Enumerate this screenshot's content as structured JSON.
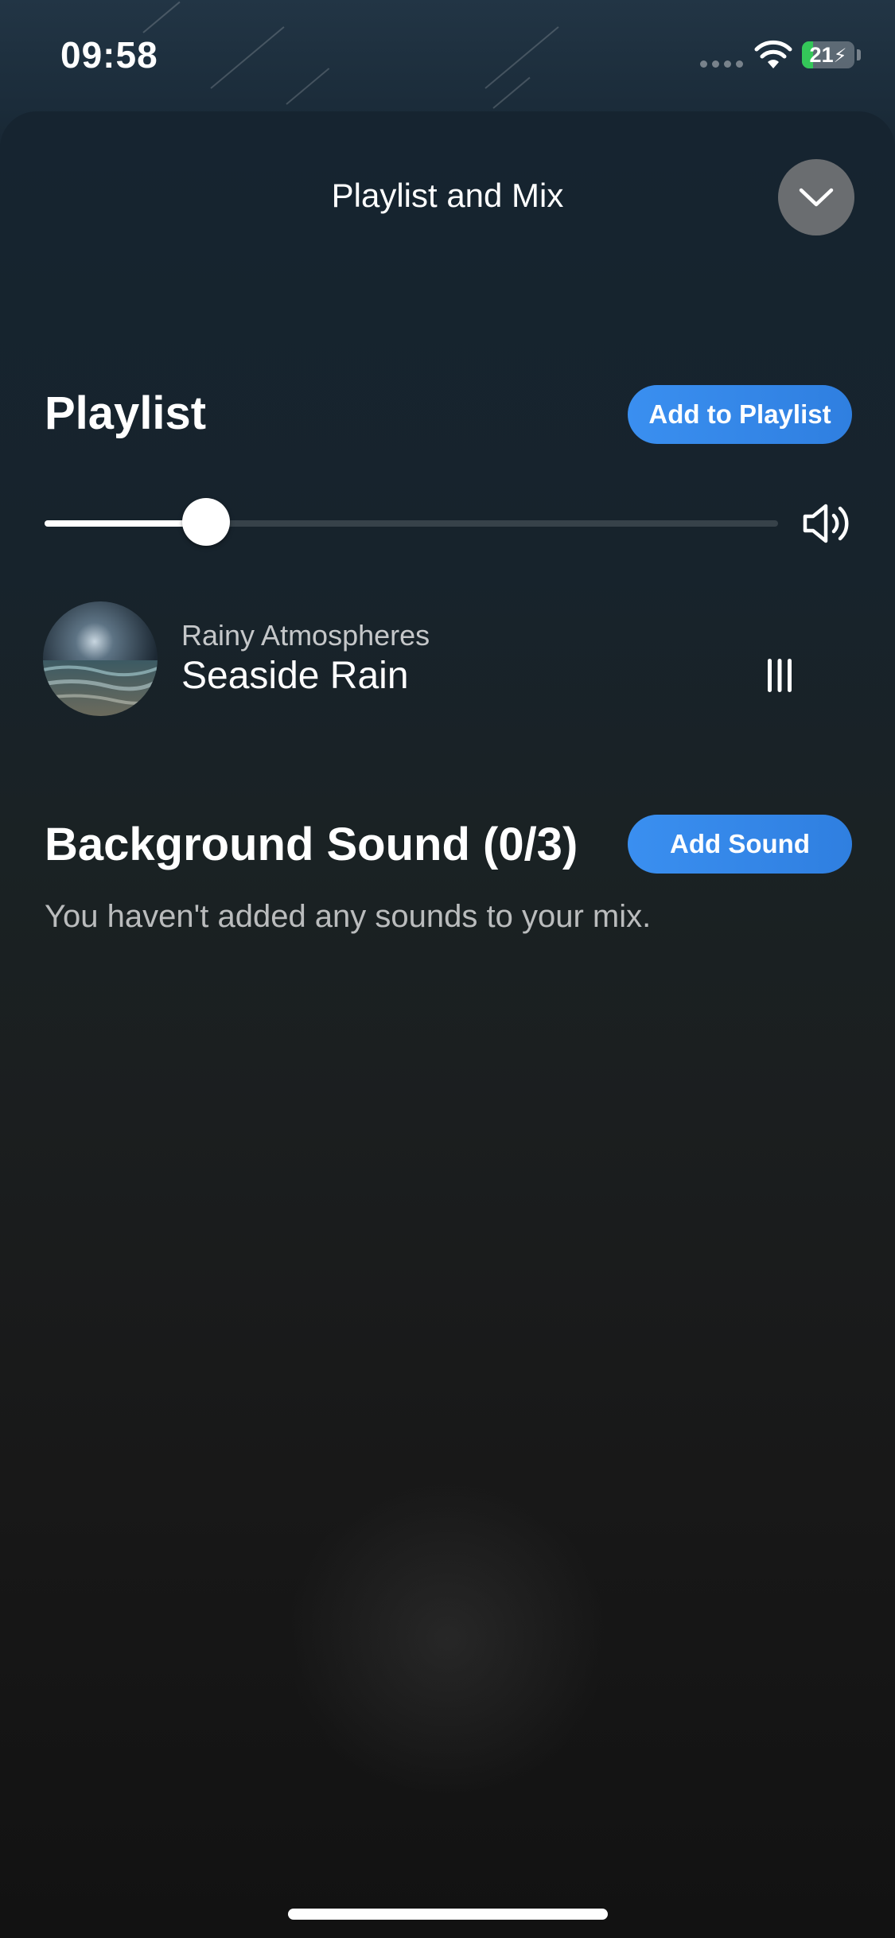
{
  "status_bar": {
    "time": "09:58",
    "battery_percent": "21",
    "battery_level": 0.21,
    "charging": true,
    "wifi_icon": "wifi-icon"
  },
  "sheet": {
    "title": "Playlist and Mix",
    "collapse_icon": "chevron-down-icon"
  },
  "playlist": {
    "title": "Playlist",
    "add_button_label": "Add to Playlist",
    "volume_level": 0.22,
    "volume_icon": "speaker-icon",
    "tracks": [
      {
        "subtitle": "Rainy Atmospheres",
        "title": "Seaside Rain",
        "handle_icon": "drag-handle-icon"
      }
    ]
  },
  "background_sound": {
    "title": "Background Sound (0/3)",
    "add_button_label": "Add Sound",
    "empty_message": "You haven't added any sounds to your mix."
  },
  "colors": {
    "accent": "#3a8ff0",
    "battery": "#34c759"
  }
}
